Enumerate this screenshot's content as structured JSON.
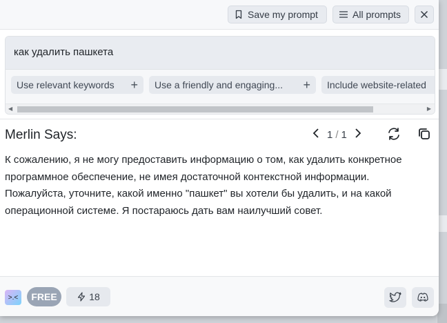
{
  "toolbar": {
    "save_label": "Save my prompt",
    "all_label": "All prompts"
  },
  "prompt": {
    "value": "как удалить пашкета",
    "chips": [
      {
        "label": "Use relevant keywords"
      },
      {
        "label": "Use a friendly and engaging..."
      },
      {
        "label": "Include website-related"
      }
    ]
  },
  "response": {
    "header": "Merlin Says:",
    "page_current": "1",
    "page_sep": "/",
    "page_total": "1",
    "text": "К сожалению, я не могу предоставить информацию о том, как удалить конкретное программное обеспечение, не имея достаточной контекстной информации. Пожалуйста, уточните, какой именно \"пашкет\" вы хотели бы удалить, и на какой операционной системе. Я постараюсь дать вам наилучший совет."
  },
  "footer": {
    "plan": "FREE",
    "credits": "18"
  },
  "icons": {
    "save": "bookmark-icon",
    "all": "list-icon",
    "close": "close-icon",
    "add": "plus-icon",
    "prev": "chevron-left-icon",
    "next": "chevron-right-icon",
    "refresh": "refresh-icon",
    "copy": "copy-icon",
    "credits": "lightning-icon",
    "twitter": "twitter-icon",
    "discord": "discord-icon"
  }
}
